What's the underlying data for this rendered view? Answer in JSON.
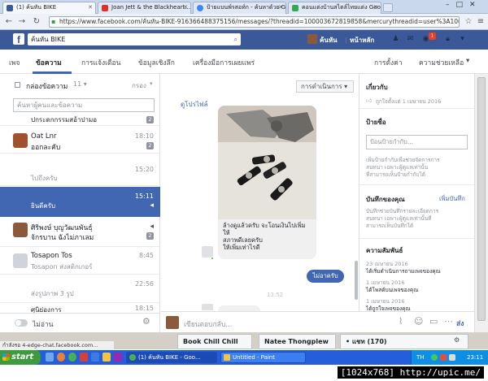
{
  "browser": {
    "tabs": [
      {
        "title": "(1) ค้นหัน BIKE",
        "fav_color": "#3b5998"
      },
      {
        "title": "Joan Jett & the Blackheart...",
        "fav_color": "#e52d27"
      },
      {
        "title": "ป้ายแบนพ์รสอท์ก - ค้นหาด้วย Goo...",
        "fav_color": "#4285f4"
      },
      {
        "title": "คอนแต่งบ้านสไตล์ไทยแต่ง Goo...",
        "fav_color": "#34a853"
      }
    ],
    "url": "https://www.facebook.com/ค้นหัน-BIKE-916366488375156/messages/?threadid=100003672819858&mercurythreadid=user%3A100000",
    "window_controls": [
      "–",
      "□",
      "✕"
    ]
  },
  "fb": {
    "page_name_search": "ค้นหัน BIKE",
    "user_name": "ค้นหัน",
    "home_label": "หน้าหลัก",
    "notification_count": "1"
  },
  "page_nav": {
    "items": [
      "เพจ",
      "ข้อความ",
      "การแจ้งเตือน",
      "ข้อมูลเชิงลึก",
      "เครื่องมือการเผยแพร่"
    ],
    "right_items": [
      "การตั้งค่า",
      "ความช่วยเหลือ"
    ]
  },
  "inbox": {
    "folder_label": "กล่องข้อความ",
    "filter_label": "กรอง",
    "search_placeholder": "ค้นหาผู้คนและข้อความ",
    "conversations": [
      {
        "name": "",
        "preview": "ปกระดกกรรมสอ้าปามอ",
        "time": "",
        "badge": "2",
        "avatar": ""
      },
      {
        "name": "Oat Lnr",
        "preview": "ออกละคับ",
        "time": "18:10",
        "badge": "2",
        "avatar": "#a0522d"
      },
      {
        "name": "",
        "preview": "ไปถึงครับ",
        "time": "15:20",
        "badge": "",
        "avatar": ""
      },
      {
        "name": "",
        "preview": "ยินดีครับ",
        "time": "15:11",
        "badge": "",
        "avatar": ""
      },
      {
        "name": "ศิริพงษ์ บุญวัฒนพันธุ์",
        "preview": "จ้กรบาน ฉังไม่ภาเลม",
        "time": "",
        "badge": "2",
        "avatar": "#8b5a3c"
      },
      {
        "name": "Tosapon Tos",
        "preview": "Tosapon ส่งสติกเกอร์",
        "time": "8:45",
        "badge": "",
        "avatar": "#cfd3da"
      },
      {
        "name": "",
        "preview": "ส่งรูปภาพ 3 รูป",
        "time": "22:56",
        "badge": "",
        "avatar": ""
      },
      {
        "name": "",
        "preview": "ศุนิย่องการ",
        "time": "18:15",
        "badge": "",
        "avatar": ""
      }
    ],
    "unread_toggle_label": "ไม่อ่าน"
  },
  "thread": {
    "actions_label": "การดำเนินการ",
    "profile_link": "ดูโปรไฟล์",
    "incoming_text": [
      "ล้างดูแล้วครับ จะโอนเงินไปเพิ่มให้",
      "สภาพดีเลยครับ",
      "ให้เพิ่มเท่าไรดี"
    ],
    "outgoing_text": "ไม่อาครับ",
    "timestamp": "13:52",
    "composer_placeholder": "เขียนตอบกลับ...",
    "send_label": "ส่ง"
  },
  "sidebar": {
    "about_title": "เกี่ยวกับ",
    "about_detail": "ถูกใจตั้งแต่ 1 เมษายน 2016",
    "labels_title": "ป้ายชื่อ",
    "label_placeholder": "ป้อนป้ายกำกับ...",
    "labels_help": [
      "เพิ่มป้ายกำกับเพื่อช่วยจัดการการ",
      "สนทนา เฉพาะผู้ดูแลเท่านั้น",
      "ที่สามารถเห็นป้ายกำกับได้"
    ],
    "notes_title": "บันทึกของคุณ",
    "notes_add": "เพิ่มบันทึก",
    "notes_help": [
      "บันทึกช่วยบันทึกรายละเอียดการ",
      "สนทนา เฉพาะผู้ดูแลเท่านั้นที่",
      "สามารถเห็นบันทึกได้"
    ],
    "activity_title": "ความสัมพันธ์",
    "activity": [
      {
        "date": "23 เมษายน 2016",
        "text": "ได้เริ่มดำเนินการถามเพจของคุณ"
      },
      {
        "date": "1 เมษายน 2016",
        "text": "ได้โพสต์บนเพจของคุณ"
      },
      {
        "date": "1 เมษายน 2016",
        "text": "ได้ถูกใจเพจของคุณ"
      }
    ]
  },
  "chat_tabs": [
    {
      "label": "Book Chill Chill"
    },
    {
      "label": "Natee Thongplew"
    },
    {
      "label": "• แชท (170)"
    }
  ],
  "status_text": "กำลังรอ 4-edge-chat.facebook.com...",
  "taskbar": {
    "start_label": "start",
    "tasks": [
      {
        "label": "(1) ค้นหัน BIKE - Goo..."
      },
      {
        "label": "Untitled - Paint"
      }
    ],
    "lang": "TH",
    "clock": "23:11"
  },
  "resolution_tag": "[1024x768] http://upic.me/",
  "colors": {
    "fb_blue": "#3b5998",
    "selected_row": "#4267b2"
  }
}
